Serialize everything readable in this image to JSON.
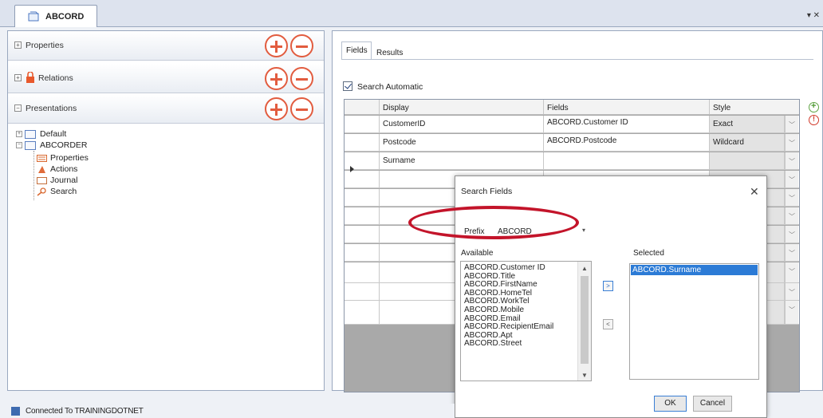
{
  "document_tab": {
    "label": "ABCORD"
  },
  "window_controls": "▾ ✕",
  "left_panel": {
    "sections": [
      {
        "label": "Properties",
        "expander": "+"
      },
      {
        "label": "Relations",
        "expander": "+"
      },
      {
        "label": "Presentations",
        "expander": "−"
      }
    ],
    "tree": {
      "default": "Default",
      "abcorder": "ABCORDER",
      "children": [
        "Properties",
        "Actions",
        "Journal",
        "Search"
      ]
    }
  },
  "right_panel": {
    "tabs": [
      "Fields",
      "Results"
    ],
    "search_automatic": "Search Automatic",
    "grid": {
      "headers": [
        "Display",
        "Fields",
        "Style"
      ],
      "rows": [
        {
          "display": "CustomerID",
          "fields": "ABCORD.Customer ID",
          "style": "Exact"
        },
        {
          "display": "Postcode",
          "fields": "ABCORD.Postcode",
          "style": "Wildcard"
        },
        {
          "display": "Surname",
          "fields": "",
          "style": ""
        }
      ]
    }
  },
  "dialog": {
    "title": "Search Fields",
    "prefix_label": "Prefix",
    "prefix_value": "ABCORD",
    "available_label": "Available",
    "selected_label": "Selected",
    "available": [
      "ABCORD.Customer ID",
      "ABCORD.Title",
      "ABCORD.FirstName",
      "ABCORD.HomeTel",
      "ABCORD.WorkTel",
      "ABCORD.Mobile",
      "ABCORD.Email",
      "ABCORD.RecipientEmail",
      "ABCORD.Apt",
      "ABCORD.Street"
    ],
    "selected": [
      "ABCORD.Surname"
    ],
    "move_right": ">",
    "move_left": "<",
    "ok": "OK",
    "cancel": "Cancel"
  },
  "status": {
    "text": "Connected To TRAININGDOTNET"
  },
  "colors": {
    "highlight_oval": "#c3142a",
    "add_remove": "#e25c3f",
    "selection": "#2c7bd6"
  }
}
